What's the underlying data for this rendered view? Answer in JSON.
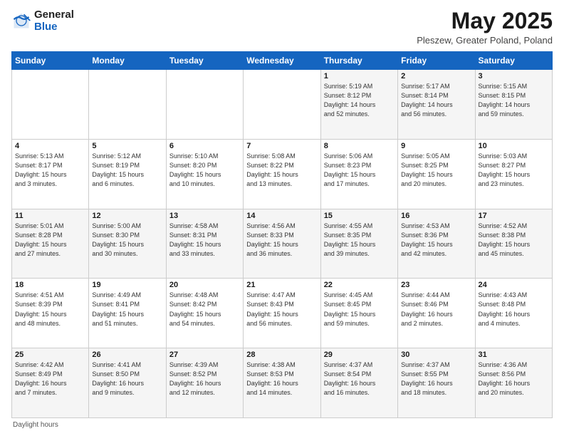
{
  "header": {
    "logo_general": "General",
    "logo_blue": "Blue",
    "title": "May 2025",
    "location": "Pleszew, Greater Poland, Poland"
  },
  "days_of_week": [
    "Sunday",
    "Monday",
    "Tuesday",
    "Wednesday",
    "Thursday",
    "Friday",
    "Saturday"
  ],
  "footer": "Daylight hours",
  "weeks": [
    [
      {
        "num": "",
        "info": ""
      },
      {
        "num": "",
        "info": ""
      },
      {
        "num": "",
        "info": ""
      },
      {
        "num": "",
        "info": ""
      },
      {
        "num": "1",
        "info": "Sunrise: 5:19 AM\nSunset: 8:12 PM\nDaylight: 14 hours\nand 52 minutes."
      },
      {
        "num": "2",
        "info": "Sunrise: 5:17 AM\nSunset: 8:14 PM\nDaylight: 14 hours\nand 56 minutes."
      },
      {
        "num": "3",
        "info": "Sunrise: 5:15 AM\nSunset: 8:15 PM\nDaylight: 14 hours\nand 59 minutes."
      }
    ],
    [
      {
        "num": "4",
        "info": "Sunrise: 5:13 AM\nSunset: 8:17 PM\nDaylight: 15 hours\nand 3 minutes."
      },
      {
        "num": "5",
        "info": "Sunrise: 5:12 AM\nSunset: 8:19 PM\nDaylight: 15 hours\nand 6 minutes."
      },
      {
        "num": "6",
        "info": "Sunrise: 5:10 AM\nSunset: 8:20 PM\nDaylight: 15 hours\nand 10 minutes."
      },
      {
        "num": "7",
        "info": "Sunrise: 5:08 AM\nSunset: 8:22 PM\nDaylight: 15 hours\nand 13 minutes."
      },
      {
        "num": "8",
        "info": "Sunrise: 5:06 AM\nSunset: 8:23 PM\nDaylight: 15 hours\nand 17 minutes."
      },
      {
        "num": "9",
        "info": "Sunrise: 5:05 AM\nSunset: 8:25 PM\nDaylight: 15 hours\nand 20 minutes."
      },
      {
        "num": "10",
        "info": "Sunrise: 5:03 AM\nSunset: 8:27 PM\nDaylight: 15 hours\nand 23 minutes."
      }
    ],
    [
      {
        "num": "11",
        "info": "Sunrise: 5:01 AM\nSunset: 8:28 PM\nDaylight: 15 hours\nand 27 minutes."
      },
      {
        "num": "12",
        "info": "Sunrise: 5:00 AM\nSunset: 8:30 PM\nDaylight: 15 hours\nand 30 minutes."
      },
      {
        "num": "13",
        "info": "Sunrise: 4:58 AM\nSunset: 8:31 PM\nDaylight: 15 hours\nand 33 minutes."
      },
      {
        "num": "14",
        "info": "Sunrise: 4:56 AM\nSunset: 8:33 PM\nDaylight: 15 hours\nand 36 minutes."
      },
      {
        "num": "15",
        "info": "Sunrise: 4:55 AM\nSunset: 8:35 PM\nDaylight: 15 hours\nand 39 minutes."
      },
      {
        "num": "16",
        "info": "Sunrise: 4:53 AM\nSunset: 8:36 PM\nDaylight: 15 hours\nand 42 minutes."
      },
      {
        "num": "17",
        "info": "Sunrise: 4:52 AM\nSunset: 8:38 PM\nDaylight: 15 hours\nand 45 minutes."
      }
    ],
    [
      {
        "num": "18",
        "info": "Sunrise: 4:51 AM\nSunset: 8:39 PM\nDaylight: 15 hours\nand 48 minutes."
      },
      {
        "num": "19",
        "info": "Sunrise: 4:49 AM\nSunset: 8:41 PM\nDaylight: 15 hours\nand 51 minutes."
      },
      {
        "num": "20",
        "info": "Sunrise: 4:48 AM\nSunset: 8:42 PM\nDaylight: 15 hours\nand 54 minutes."
      },
      {
        "num": "21",
        "info": "Sunrise: 4:47 AM\nSunset: 8:43 PM\nDaylight: 15 hours\nand 56 minutes."
      },
      {
        "num": "22",
        "info": "Sunrise: 4:45 AM\nSunset: 8:45 PM\nDaylight: 15 hours\nand 59 minutes."
      },
      {
        "num": "23",
        "info": "Sunrise: 4:44 AM\nSunset: 8:46 PM\nDaylight: 16 hours\nand 2 minutes."
      },
      {
        "num": "24",
        "info": "Sunrise: 4:43 AM\nSunset: 8:48 PM\nDaylight: 16 hours\nand 4 minutes."
      }
    ],
    [
      {
        "num": "25",
        "info": "Sunrise: 4:42 AM\nSunset: 8:49 PM\nDaylight: 16 hours\nand 7 minutes."
      },
      {
        "num": "26",
        "info": "Sunrise: 4:41 AM\nSunset: 8:50 PM\nDaylight: 16 hours\nand 9 minutes."
      },
      {
        "num": "27",
        "info": "Sunrise: 4:39 AM\nSunset: 8:52 PM\nDaylight: 16 hours\nand 12 minutes."
      },
      {
        "num": "28",
        "info": "Sunrise: 4:38 AM\nSunset: 8:53 PM\nDaylight: 16 hours\nand 14 minutes."
      },
      {
        "num": "29",
        "info": "Sunrise: 4:37 AM\nSunset: 8:54 PM\nDaylight: 16 hours\nand 16 minutes."
      },
      {
        "num": "30",
        "info": "Sunrise: 4:37 AM\nSunset: 8:55 PM\nDaylight: 16 hours\nand 18 minutes."
      },
      {
        "num": "31",
        "info": "Sunrise: 4:36 AM\nSunset: 8:56 PM\nDaylight: 16 hours\nand 20 minutes."
      }
    ]
  ]
}
